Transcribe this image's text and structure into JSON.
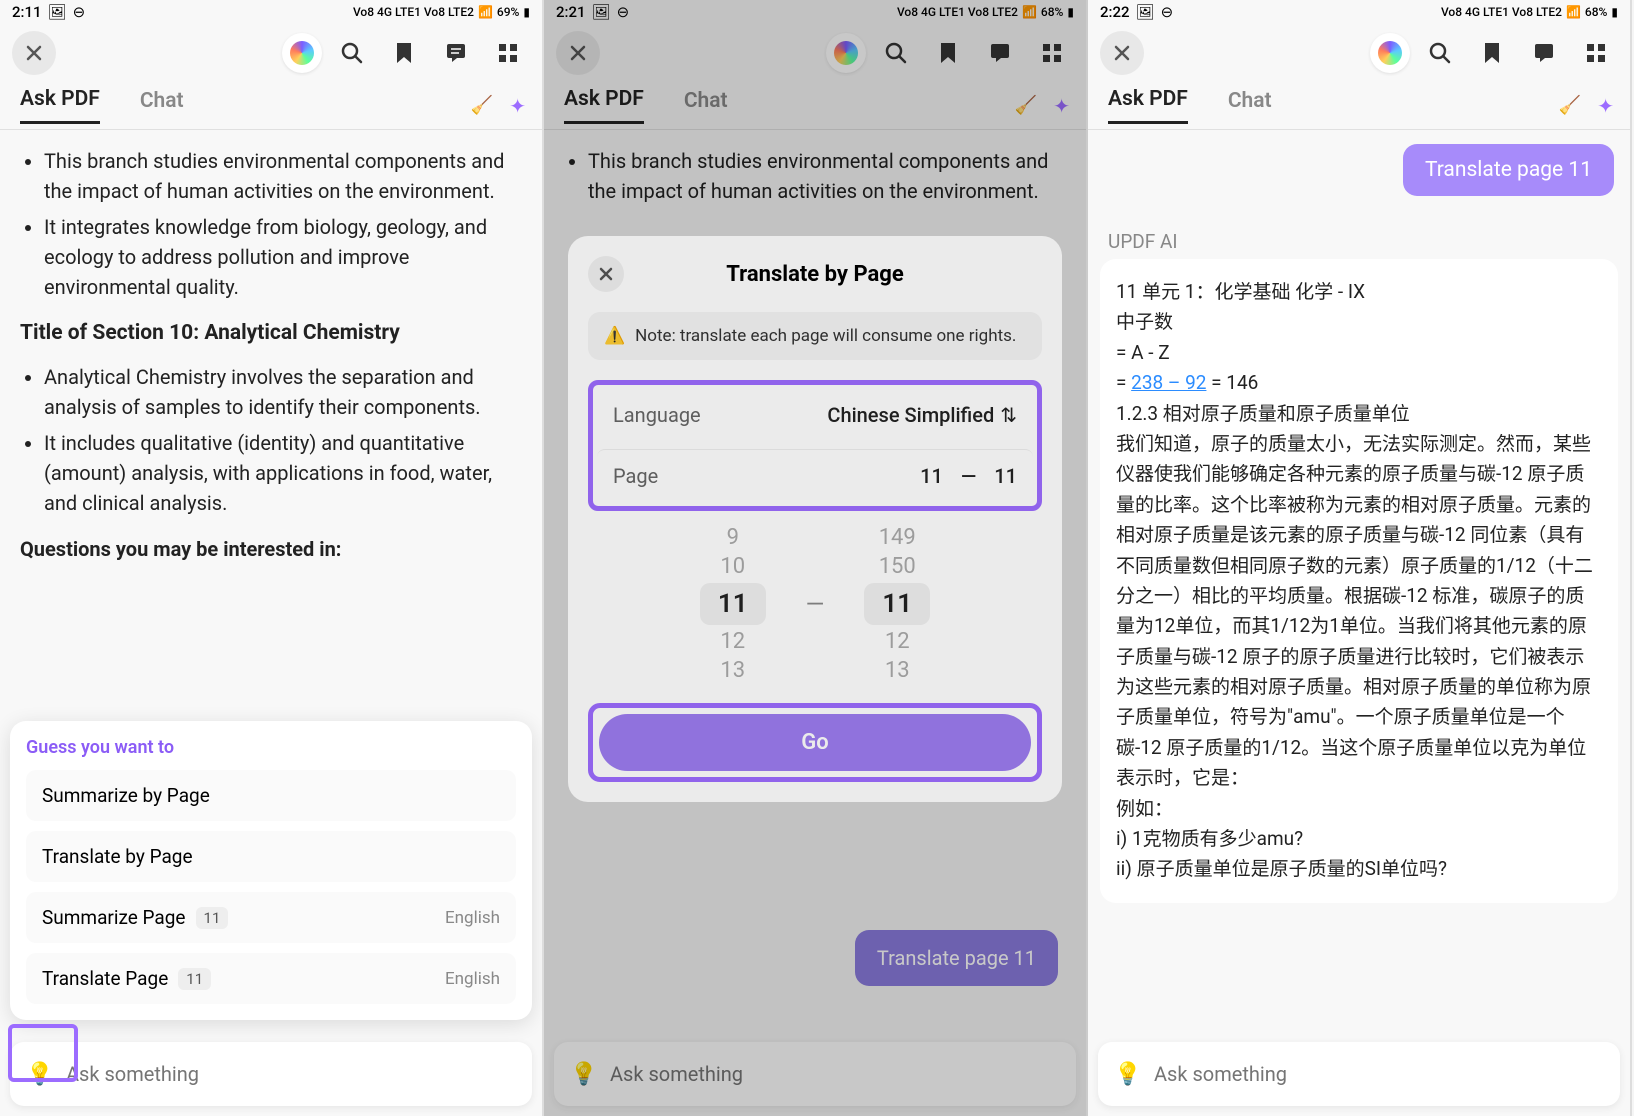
{
  "screen1": {
    "status": {
      "time": "2:11",
      "battery": "69%",
      "signal": "Vo8 4G LTE1 Vo8 LTE2"
    },
    "tabs": {
      "active": "Ask PDF",
      "inactive": "Chat"
    },
    "content": {
      "bullet1": "This branch studies environmental components and the impact of human activities on the environment.",
      "bullet2": "It integrates knowledge from biology, geology, and ecology to address pollution and improve environmental quality.",
      "section_title": "Title of Section 10: Analytical Chemistry",
      "bullet3": "Analytical Chemistry involves the separation and analysis of samples to identify their components.",
      "bullet4": "It includes qualitative (identity) and quantitative (amount) analysis, with applications in food, water, and clinical analysis.",
      "questions": "Questions you may be interested in:"
    },
    "guess": {
      "title": "Guess you want to",
      "items": [
        {
          "label": "Summarize by Page"
        },
        {
          "label": "Translate by Page"
        },
        {
          "label": "Summarize Page",
          "badge": "11",
          "lang": "English"
        },
        {
          "label": "Translate Page",
          "badge": "11",
          "lang": "English"
        }
      ]
    },
    "ask_placeholder": "Ask something"
  },
  "screen2": {
    "status": {
      "time": "2:21",
      "battery": "68%",
      "signal": "Vo8 4G LTE1 Vo8 LTE2"
    },
    "tabs": {
      "active": "Ask PDF",
      "inactive": "Chat"
    },
    "content": {
      "bullet1": "This branch studies environmental components and the impact of human activities on the environment."
    },
    "modal": {
      "title": "Translate by Page",
      "note": "Note: translate each page will consume one rights.",
      "language_label": "Language",
      "language_value": "Chinese Simplified",
      "page_label": "Page",
      "page_from": "11",
      "page_to": "11",
      "picker_left": [
        "9",
        "10",
        "11",
        "12",
        "13"
      ],
      "picker_right": [
        "149",
        "150",
        "11",
        "12",
        "13"
      ],
      "go": "Go"
    },
    "chip": "Translate page 11",
    "ask_placeholder": "Ask something"
  },
  "screen3": {
    "status": {
      "time": "2:22",
      "battery": "68%",
      "signal": "Vo8 4G LTE1 Vo8 LTE2"
    },
    "tabs": {
      "active": "Ask PDF",
      "inactive": "Chat"
    },
    "user_msg": "Translate page 11",
    "ai_label": "UPDF AI",
    "ai_body_1": "11 单元 1：化学基础 化学 - IX",
    "ai_body_2": "中子数",
    "ai_body_3": "= A - Z",
    "ai_body_4a": "= ",
    "ai_link": "238 – 92",
    "ai_body_4b": " = 146",
    "ai_body_5": "1.2.3 相对原子质量和原子质量单位",
    "ai_body_6": "我们知道，原子的质量太小，无法实际测定。然而，某些仪器使我们能够确定各种元素的原子质量与碳-12 原子质量的比率。这个比率被称为元素的相对原子质量。元素的相对原子质量是该元素的原子质量与碳-12 同位素（具有不同质量数但相同原子数的元素）原子质量的1/12（十二分之一）相比的平均质量。根据碳-12 标准，碳原子的质量为12单位，而其1/12为1单位。当我们将其他元素的原子质量与碳-12 原子的原子质量进行比较时，它们被表示为这些元素的相对原子质量。相对原子质量的单位称为原子质量单位，符号为\"amu\"。一个原子质量单位是一个碳-12 原子质量的1/12。当这个原子质量单位以克为单位表示时，它是：",
    "ai_body_7": "例如：",
    "ai_body_8": "i) 1克物质有多少amu?",
    "ai_body_9": "ii) 原子质量单位是原子质量的SI单位吗?",
    "ask_placeholder": "Ask something"
  }
}
